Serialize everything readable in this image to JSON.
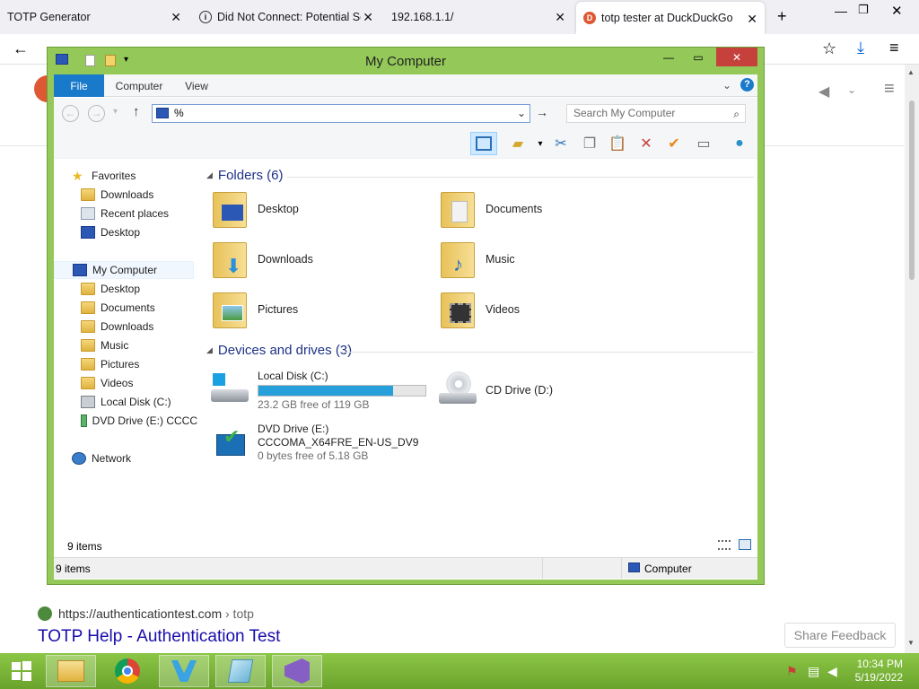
{
  "browser": {
    "tabs": [
      {
        "label": "TOTP Generator"
      },
      {
        "label": "Did Not Connect: Potential Se"
      },
      {
        "label": "192.168.1.1/"
      },
      {
        "label": "totp tester at DuckDuckGo"
      }
    ],
    "result_url": "https://authenticationtest.com",
    "result_crumb": "› totp",
    "result_title": "TOTP Help - Authentication Test",
    "feedback_label": "Share Feedback"
  },
  "explorer": {
    "title": "My Computer",
    "ribbon_tabs": [
      "File",
      "Computer",
      "View"
    ],
    "address_value": "%",
    "search_placeholder": "Search My Computer",
    "nav": {
      "favorites": "Favorites",
      "fav_items": [
        "Downloads",
        "Recent places",
        "Desktop"
      ],
      "computer": "My Computer",
      "computer_items": [
        "Desktop",
        "Documents",
        "Downloads",
        "Music",
        "Pictures",
        "Videos",
        "Local Disk (C:)",
        "DVD Drive (E:) CCCC"
      ],
      "network": "Network"
    },
    "folders_header": "Folders (6)",
    "folders": [
      "Desktop",
      "Documents",
      "Downloads",
      "Music",
      "Pictures",
      "Videos"
    ],
    "drives_header": "Devices and drives (3)",
    "drives": [
      {
        "name": "Local Disk (C:)",
        "free": "23.2 GB free of 119 GB",
        "used_fraction": 0.805
      },
      {
        "name": "CD Drive (D:)"
      },
      {
        "name": "DVD Drive (E:)",
        "label": "CCCOMA_X64FRE_EN-US_DV9",
        "free": "0 bytes free of 5.18 GB"
      }
    ],
    "item_count": "9 items",
    "status_count": "9 items",
    "status_location": "Computer"
  },
  "taskbar": {
    "time": "10:34 PM",
    "date": "5/19/2022"
  },
  "colors": {
    "window_frame": "#94c95a",
    "taskbar": "#7db43a",
    "accent_blue": "#1979ca",
    "link_blue": "#1a0dab"
  }
}
